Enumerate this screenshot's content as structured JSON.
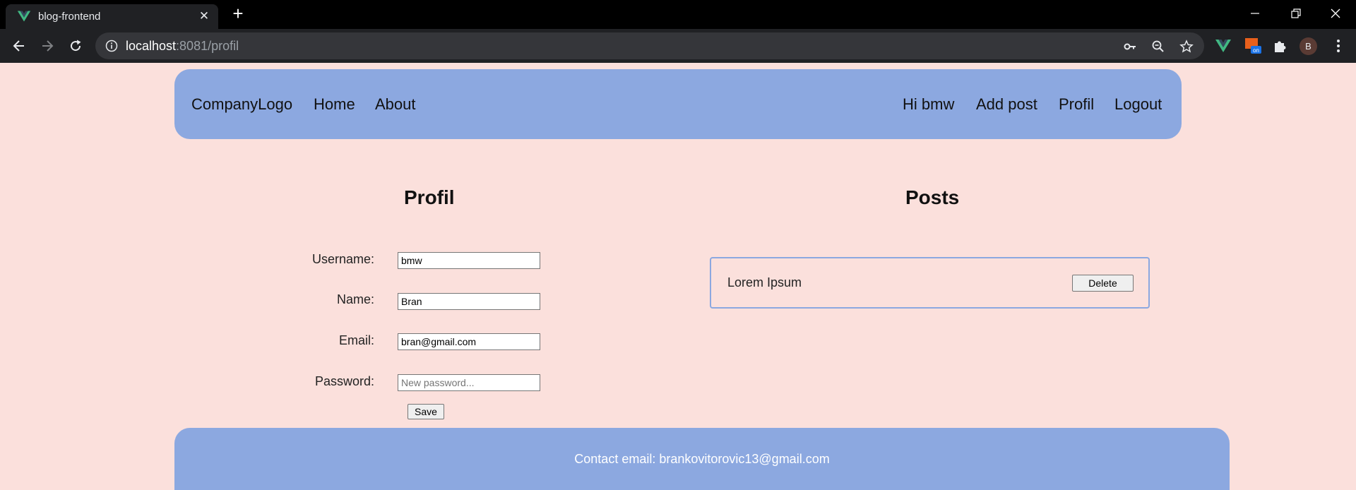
{
  "browser": {
    "tab_title": "blog-frontend",
    "url_host": "localhost",
    "url_rest": ":8081/profil",
    "avatar_letter": "B",
    "colors": {
      "tabstrip": "#000000",
      "toolbar": "#202124",
      "omnibox": "#35363a",
      "vue_green": "#41b883"
    }
  },
  "navbar": {
    "logo": "CompanyLogo",
    "home": "Home",
    "about": "About",
    "greeting": "Hi bmw",
    "add_post": "Add post",
    "profil": "Profil",
    "logout": "Logout"
  },
  "profile": {
    "title": "Profil",
    "username_label": "Username:",
    "username_value": "bmw",
    "name_label": "Name:",
    "name_value": "Bran",
    "email_label": "Email:",
    "email_value": "bran@gmail.com",
    "password_label": "Password:",
    "password_placeholder": "New password...",
    "save_label": "Save"
  },
  "posts": {
    "title": "Posts",
    "items": [
      {
        "title": "Lorem Ipsum",
        "delete_label": "Delete"
      }
    ]
  },
  "footer": {
    "text": "Contact email: brankovitorovic13@gmail.com"
  },
  "theme": {
    "page_bg": "#fbe0dc",
    "accent": "#8ca8e0"
  }
}
